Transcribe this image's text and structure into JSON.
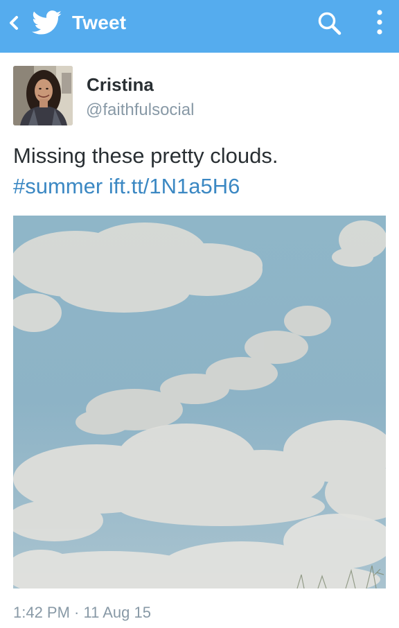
{
  "app_bar": {
    "title": "Tweet",
    "icons": [
      "chevron-left-icon",
      "twitter-bird-icon",
      "search-icon",
      "overflow-menu-icon"
    ],
    "color": "#55acee"
  },
  "tweet": {
    "author": {
      "name": "Cristina",
      "handle": "@faithfulsocial"
    },
    "text": "Missing these pretty clouds.",
    "hashtag": "#summer",
    "link": "ift.tt/1N1a5H6",
    "timestamp": "1:42 PM · 11 Aug 15"
  },
  "colors": {
    "link": "#3b88c3",
    "secondary_text": "#8899a6",
    "primary_text": "#292f33"
  }
}
